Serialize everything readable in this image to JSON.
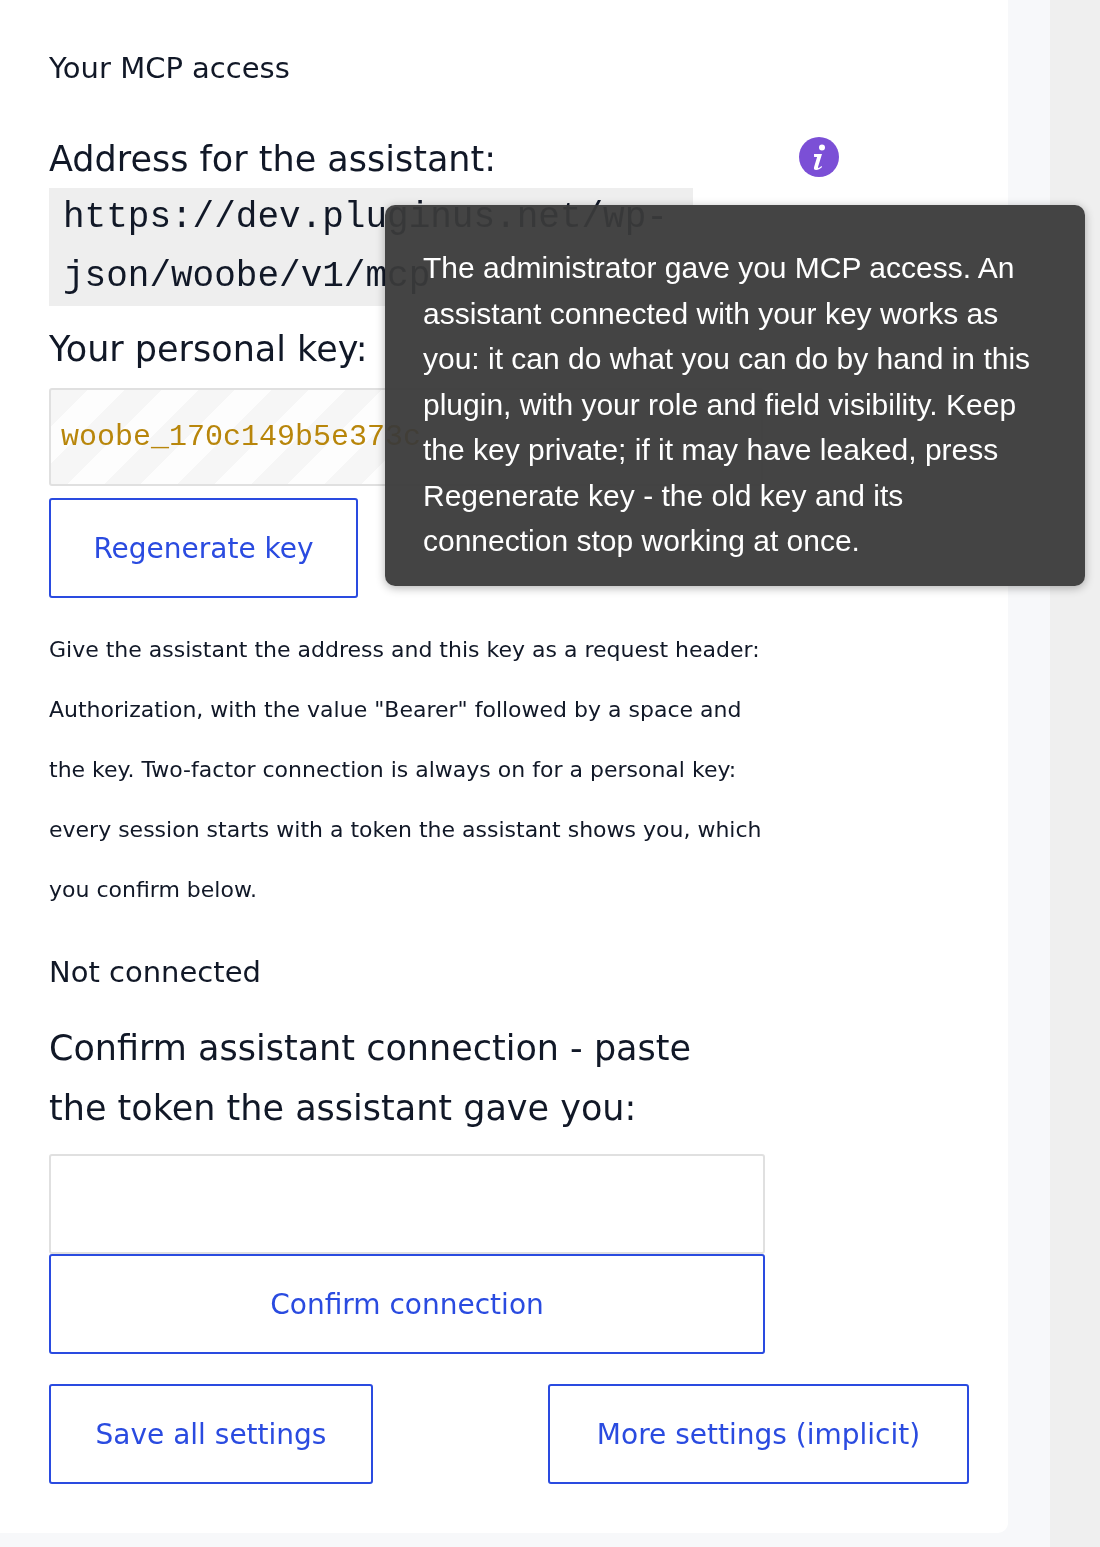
{
  "heading": "Your MCP access",
  "address": {
    "label": "Address for the assistant:",
    "value": "https://dev.pluginus.net/wp-json/woobe/v1/mcp"
  },
  "key": {
    "label": "Your personal key:",
    "value": "woobe_170c149b5e373c"
  },
  "regenerate_button": "Regenerate key",
  "instructions": "Give the assistant the address and this key as a request header: Authorization, with the value \"Bearer\" followed by a space and the key. Two-factor connection is always on for a personal key: every session starts with a token the assistant shows you, which you confirm below.",
  "status": "Not connected",
  "confirm": {
    "label": "Confirm assistant connection - paste the token the assistant gave you:",
    "button": "Confirm connection"
  },
  "tooltip": {
    "text": "The administrator gave you MCP access. An assistant connected with your key works as you: it can do what you can do by hand in this plugin, with your role and field visibility. Keep the key private; if it may have leaked, press Regenerate key - the old key and its connection stop working at once."
  },
  "footer_buttons": [
    "Save all settings",
    "More settings (implicit)"
  ]
}
